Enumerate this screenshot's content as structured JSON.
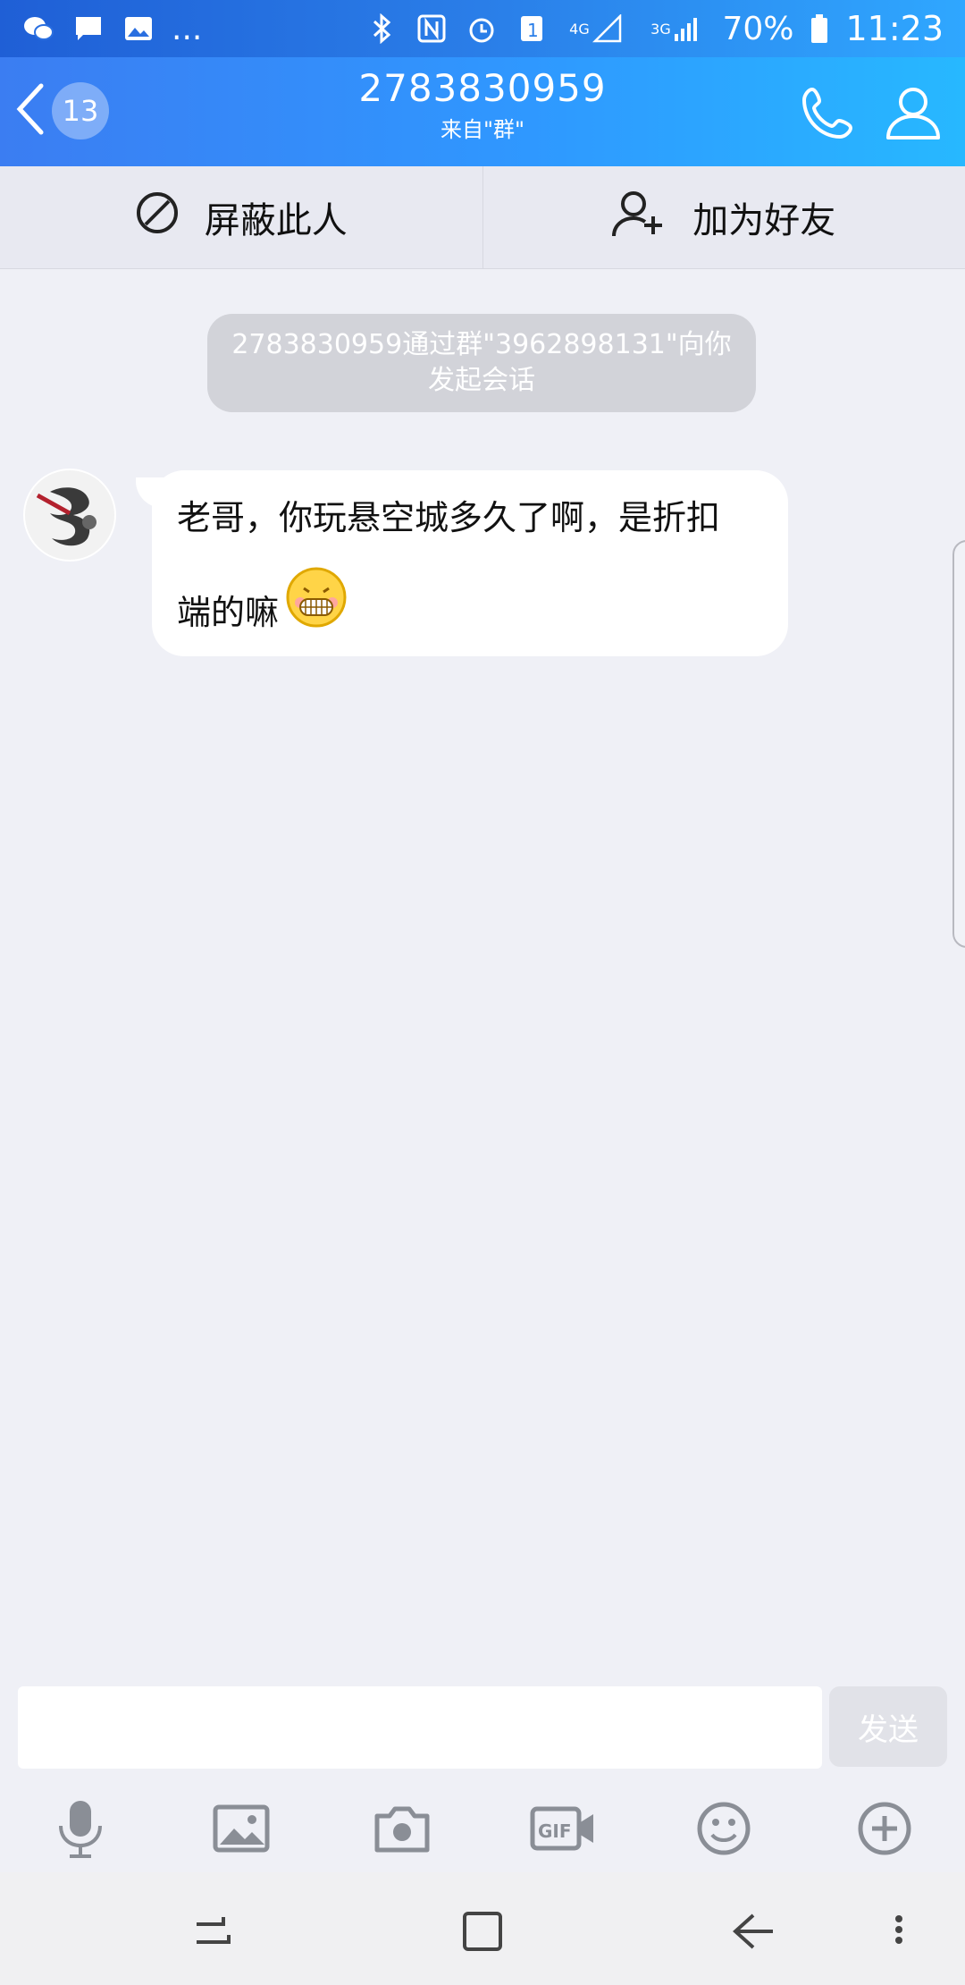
{
  "status_bar": {
    "left_icons": [
      "wechat-icon",
      "message-icon",
      "image-icon"
    ],
    "more": "...",
    "right_icons": [
      "bluetooth-icon",
      "nfc-icon",
      "alarm-icon",
      "sim-1-icon"
    ],
    "network1": "4G",
    "network2": "3G",
    "battery": "70%",
    "time": "11:23"
  },
  "title_bar": {
    "back_badge": "13",
    "title": "2783830959",
    "subtitle": "来自\"群\""
  },
  "actions": {
    "block_label": "屏蔽此人",
    "add_friend_label": "加为好友"
  },
  "notice": {
    "text": "2783830959通过群\"3962898131\"向你发起会话"
  },
  "message": {
    "line1": "老哥，你玩悬空城多久了啊，是折扣",
    "line2": "端的嘛",
    "emoji": "grinning-emoji"
  },
  "input": {
    "placeholder": "",
    "send_label": "发送"
  },
  "toolbar": [
    "mic-icon",
    "image-icon",
    "camera-icon",
    "gif-video-icon",
    "emoji-icon",
    "plus-circle-icon"
  ],
  "colors": {
    "header_start": "#3b7df2",
    "header_end": "#27b8ff",
    "background": "#eff0f6"
  }
}
